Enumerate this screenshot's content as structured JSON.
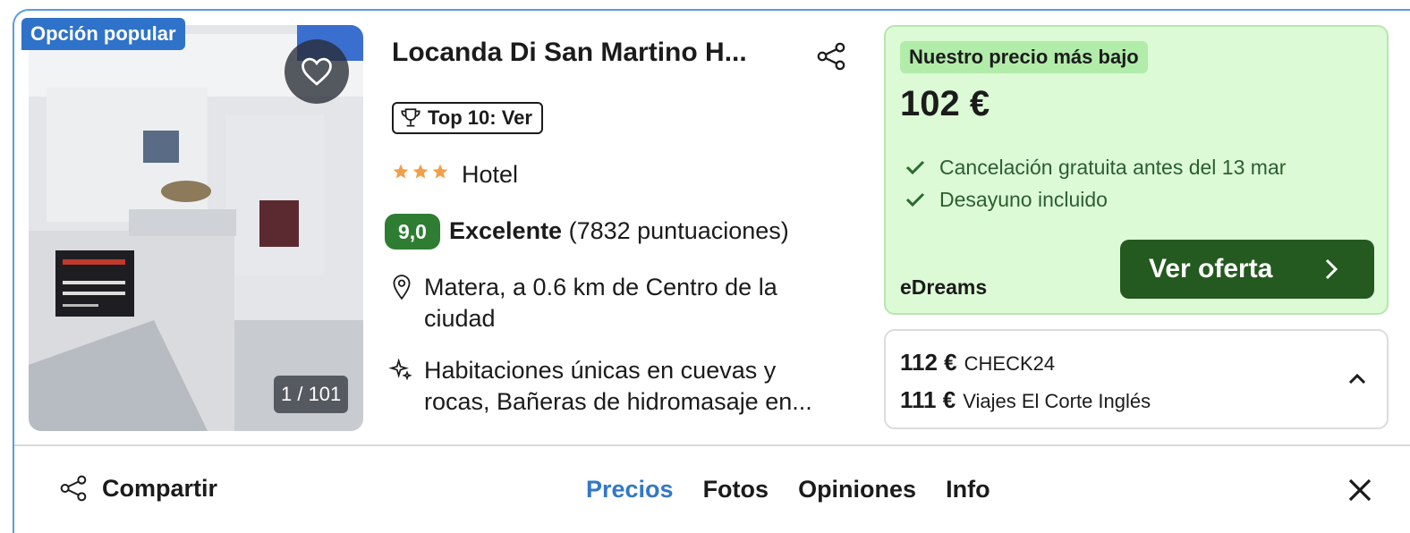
{
  "photo": {
    "badge": "Opción popular",
    "counter": "1 / 101"
  },
  "hotel": {
    "name": "Locanda Di San Martino H...",
    "top10_label": "Top 10: Ver",
    "star_count": 3,
    "type": "Hotel",
    "rating_score": "9,0",
    "rating_word": "Excelente",
    "rating_count": "(7832 puntuaciones)",
    "location": "Matera, a 0.6 km de Centro de la ciudad",
    "features": "Habitaciones únicas en cuevas y rocas, Bañeras de hidromasaje en..."
  },
  "deal": {
    "label": "Nuestro precio más bajo",
    "price": "102 €",
    "perks": [
      "Cancelación gratuita antes del 13 mar",
      "Desayuno incluido"
    ],
    "provider": "eDreams",
    "button": "Ver oferta"
  },
  "other_offers": [
    {
      "price": "112 €",
      "provider": "CHECK24"
    },
    {
      "price": "111 €",
      "provider": "Viajes El Corte Inglés"
    }
  ],
  "bottom": {
    "share": "Compartir",
    "tabs": [
      "Precios",
      "Fotos",
      "Opiniones",
      "Info"
    ],
    "active_tab": "Precios"
  },
  "colors": {
    "accent_blue": "#2f72c9",
    "rating_green": "#2e7d32",
    "deal_bg": "#dcfad6",
    "offer_button": "#24591f",
    "star": "#f0a04b"
  }
}
